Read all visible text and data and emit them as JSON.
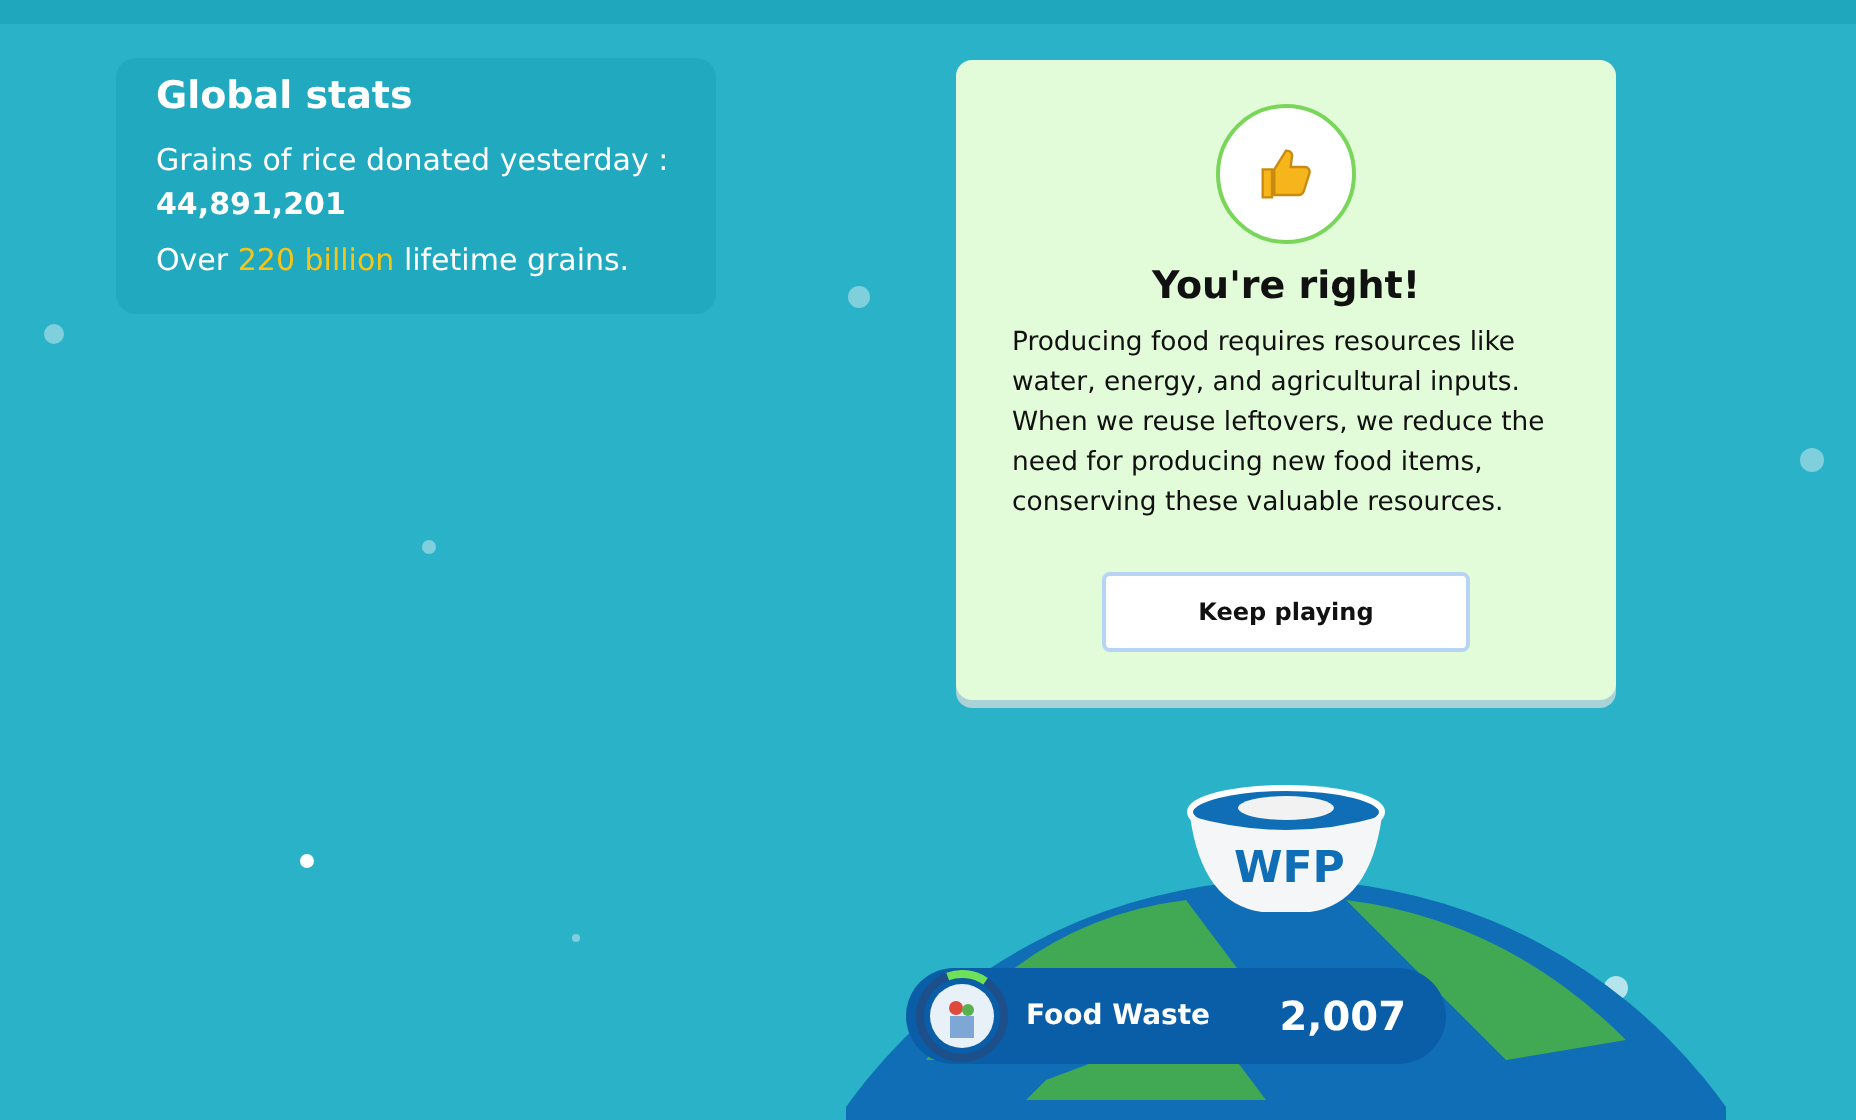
{
  "stats": {
    "title": "Global stats",
    "donated_label": "Grains of rice donated yesterday :",
    "donated_value": "44,891,201",
    "lifetime": {
      "before": "Over",
      "highlight": "220 billion",
      "after": "lifetime grains."
    }
  },
  "feedback": {
    "title": "You're right!",
    "body": "Producing food requires resources like water, energy, and agricultural inputs. When we reuse leftovers, we reduce the need for producing new food items, conserving these valuable resources.",
    "button": "Keep playing"
  },
  "bowl": {
    "label": "WFP"
  },
  "category": {
    "name": "Food Waste",
    "score": "2,007",
    "level": 0.15
  }
}
